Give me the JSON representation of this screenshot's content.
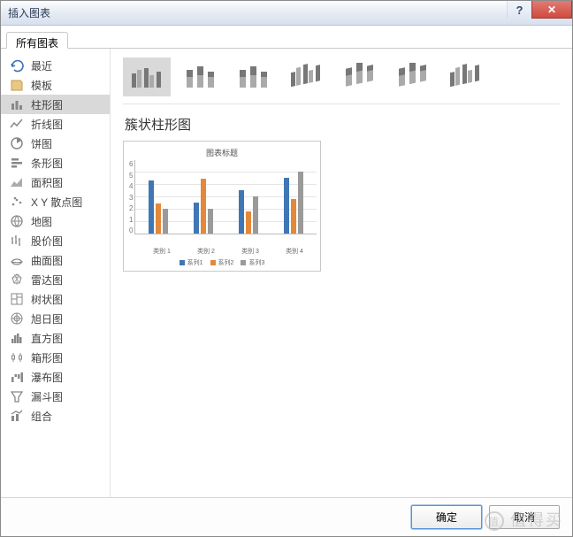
{
  "window": {
    "title": "插入图表",
    "help": "?",
    "close": "✕"
  },
  "tab": {
    "all": "所有图表"
  },
  "sidebar": {
    "items": [
      {
        "label": "最近",
        "icon": "recent-icon"
      },
      {
        "label": "模板",
        "icon": "template-icon"
      },
      {
        "label": "柱形图",
        "icon": "bar-icon",
        "selected": true
      },
      {
        "label": "折线图",
        "icon": "line-icon"
      },
      {
        "label": "饼图",
        "icon": "pie-icon"
      },
      {
        "label": "条形图",
        "icon": "hbar-icon"
      },
      {
        "label": "面积图",
        "icon": "area-icon"
      },
      {
        "label": "X Y 散点图",
        "icon": "scatter-icon"
      },
      {
        "label": "地图",
        "icon": "map-icon"
      },
      {
        "label": "股价图",
        "icon": "stock-icon"
      },
      {
        "label": "曲面图",
        "icon": "surface-icon"
      },
      {
        "label": "雷达图",
        "icon": "radar-icon"
      },
      {
        "label": "树状图",
        "icon": "treemap-icon"
      },
      {
        "label": "旭日图",
        "icon": "sunburst-icon"
      },
      {
        "label": "直方图",
        "icon": "histogram-icon"
      },
      {
        "label": "箱形图",
        "icon": "box-icon"
      },
      {
        "label": "瀑布图",
        "icon": "waterfall-icon"
      },
      {
        "label": "漏斗图",
        "icon": "funnel-icon"
      },
      {
        "label": "组合",
        "icon": "combo-icon"
      }
    ]
  },
  "subtypes": {
    "selected_name": "簇状柱形图",
    "items": [
      "clustered-column",
      "stacked-column",
      "stacked-100-column",
      "3d-clustered-column",
      "3d-stacked-column",
      "3d-stacked-100-column",
      "3d-column"
    ]
  },
  "chart_data": {
    "type": "bar",
    "title": "图表标题",
    "categories": [
      "类别 1",
      "类别 2",
      "类别 3",
      "类别 4"
    ],
    "series": [
      {
        "name": "系列1",
        "values": [
          4.3,
          2.5,
          3.5,
          4.5
        ],
        "color": "#3f77b4"
      },
      {
        "name": "系列2",
        "values": [
          2.4,
          4.4,
          1.8,
          2.8
        ],
        "color": "#e48939"
      },
      {
        "name": "系列3",
        "values": [
          2.0,
          2.0,
          3.0,
          5.0
        ],
        "color": "#9a9a9a"
      }
    ],
    "ylim": [
      0,
      6
    ],
    "yticks": [
      0,
      1,
      2,
      3,
      4,
      5,
      6
    ],
    "xlabel": "",
    "ylabel": ""
  },
  "footer": {
    "ok": "确定",
    "cancel": "取消"
  },
  "watermark": "值得买"
}
